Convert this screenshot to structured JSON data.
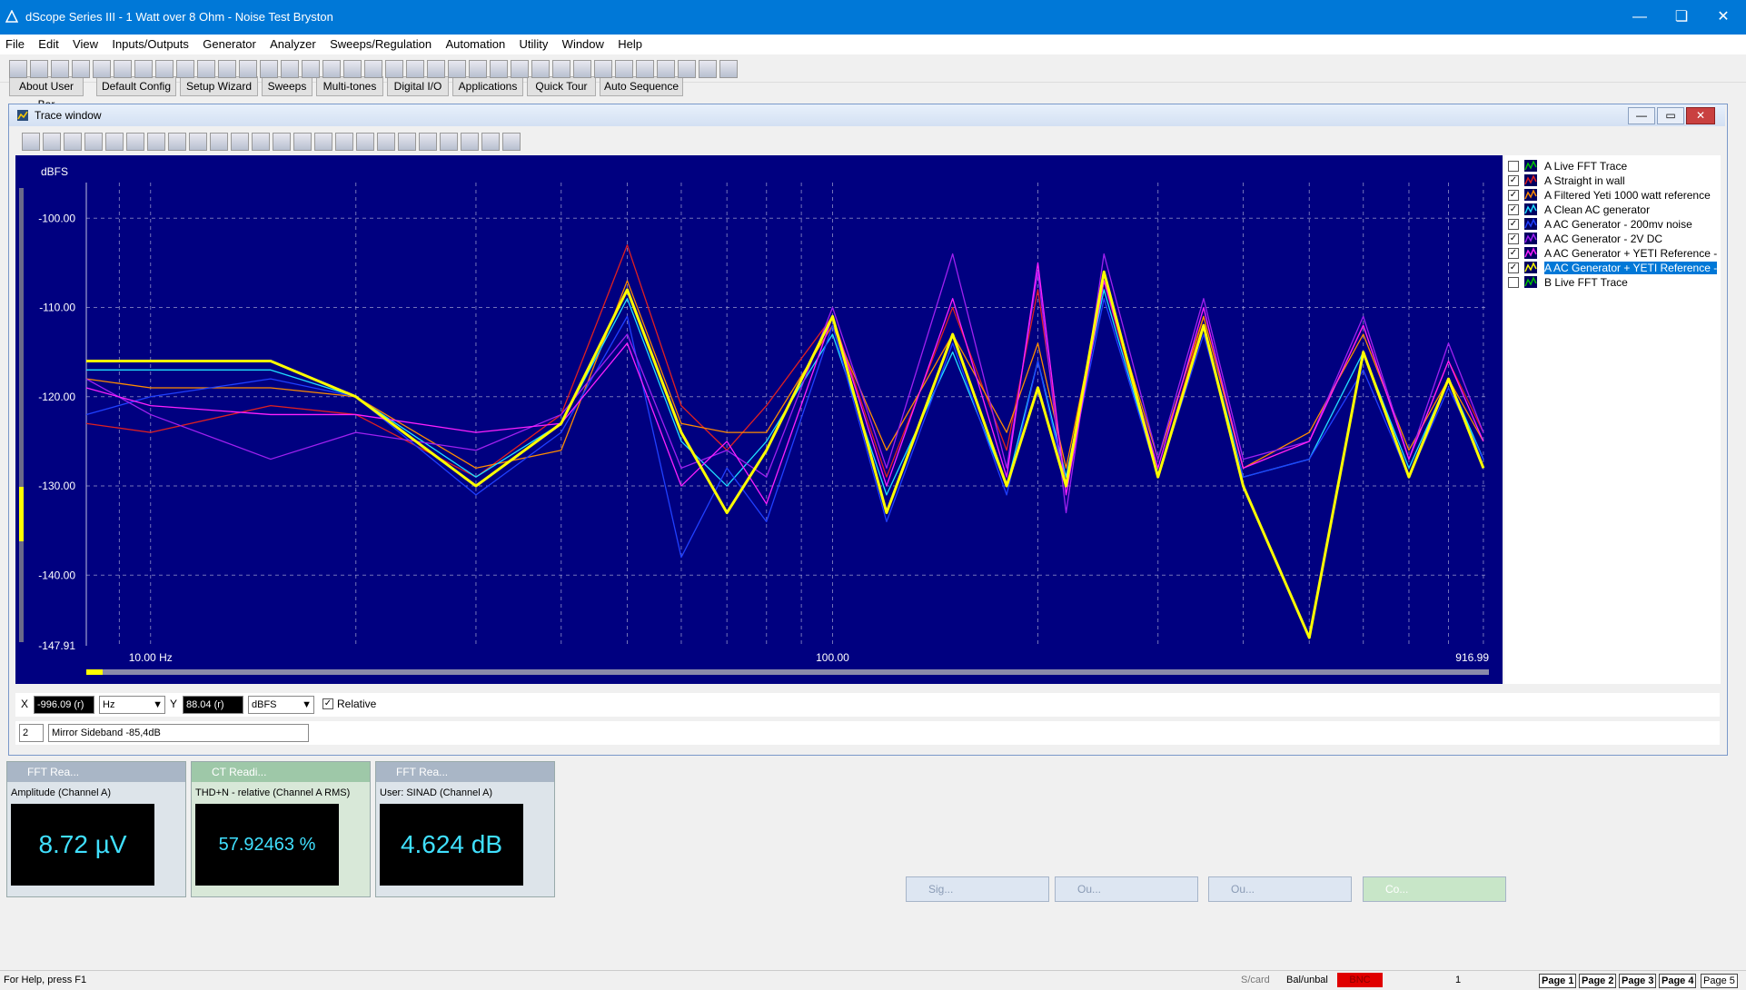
{
  "app": {
    "title": "dScope Series III - 1 Watt over 8 Ohm - Noise Test Bryston",
    "menu": [
      "File",
      "Edit",
      "View",
      "Inputs/Outputs",
      "Generator",
      "Analyzer",
      "Sweeps/Regulation",
      "Automation",
      "Utility",
      "Window",
      "Help"
    ]
  },
  "userbar": [
    "About User Bar",
    "Default Config",
    "Setup Wizard",
    "Sweeps",
    "Multi-tones",
    "Digital I/O",
    "Applications",
    "Quick Tour",
    "Auto Sequence"
  ],
  "trace_window": {
    "title": "Trace window",
    "legend": [
      {
        "label": "A  Live FFT Trace",
        "checked": false,
        "color": "#00c000"
      },
      {
        "label": "A  Straight in wall",
        "checked": true,
        "color": "#e02020"
      },
      {
        "label": "A  Filtered Yeti 1000 watt reference",
        "checked": true,
        "color": "#ff8c00"
      },
      {
        "label": "A  Clean AC generator",
        "checked": true,
        "color": "#20e0ff"
      },
      {
        "label": "A   AC Generator - 200mv noise",
        "checked": true,
        "color": "#2040ff"
      },
      {
        "label": "A  AC Generator - 2V DC",
        "checked": true,
        "color": "#a020f0"
      },
      {
        "label": "A  AC Generator + YETI Reference -",
        "checked": true,
        "color": "#ff20ff"
      },
      {
        "label": "A  AC Generator + YETI Reference -",
        "checked": true,
        "color": "#ffff00",
        "selected": true
      },
      {
        "label": "B  Live FFT Trace",
        "checked": false,
        "color": "#00c000"
      }
    ],
    "x_field": "-996.09 (r)",
    "x_unit": "Hz",
    "y_field": "88.04 (r)",
    "y_unit": "dBFS",
    "relative_label": "Relative",
    "marker_num": "2",
    "marker_text": "Mirror Sideband -85,4dB"
  },
  "chart_data": {
    "type": "line",
    "ylabel": "dBFS",
    "x_scale": "log",
    "xlim": [
      8.05,
      916.99
    ],
    "ylim": [
      -147.91,
      -96
    ],
    "y_ticks": [
      "-100.00",
      "-110.00",
      "-120.00",
      "-130.00",
      "-140.00",
      "-147.91"
    ],
    "x_ticks": [
      "10.00 Hz",
      "100.00",
      "916.99"
    ],
    "grid": true,
    "series": [
      {
        "name": "Straight in wall",
        "color": "#e02020",
        "x": [
          8,
          10,
          15,
          20,
          30,
          40,
          50,
          60,
          70,
          80,
          100,
          120,
          150,
          180,
          200,
          220,
          250,
          300,
          350,
          400,
          500,
          600,
          700,
          800,
          900
        ],
        "y": [
          -123,
          -124,
          -121,
          -122,
          -129,
          -122,
          -103,
          -121,
          -126,
          -121,
          -111,
          -129,
          -110,
          -126,
          -108,
          -130,
          -107,
          -129,
          -111,
          -128,
          -125,
          -112,
          -127,
          -116,
          -124
        ]
      },
      {
        "name": "Filtered Yeti 1000 watt reference",
        "color": "#ff8c00",
        "x": [
          8,
          10,
          15,
          20,
          30,
          40,
          50,
          60,
          70,
          80,
          100,
          120,
          150,
          180,
          200,
          220,
          250,
          300,
          350,
          400,
          500,
          600,
          700,
          800,
          900
        ],
        "y": [
          -118,
          -119,
          -119,
          -120,
          -128,
          -126,
          -107,
          -123,
          -124,
          -124,
          -112,
          -126,
          -113,
          -124,
          -114,
          -128,
          -107,
          -127,
          -111,
          -128,
          -124,
          -113,
          -126,
          -118,
          -125
        ]
      },
      {
        "name": "Clean AC generator",
        "color": "#20e0ff",
        "x": [
          8,
          10,
          15,
          20,
          30,
          40,
          50,
          60,
          70,
          80,
          100,
          120,
          150,
          180,
          200,
          220,
          250,
          300,
          350,
          400,
          500,
          600,
          700,
          800,
          900
        ],
        "y": [
          -117,
          -117,
          -117,
          -120,
          -129,
          -123,
          -109,
          -125,
          -130,
          -125,
          -113,
          -131,
          -115,
          -130,
          -116,
          -129,
          -108,
          -129,
          -112,
          -129,
          -127,
          -115,
          -128,
          -118,
          -127
        ]
      },
      {
        "name": "AC Generator - 200mv noise",
        "color": "#2040ff",
        "x": [
          8,
          10,
          15,
          20,
          30,
          40,
          50,
          60,
          70,
          80,
          100,
          120,
          150,
          180,
          200,
          220,
          250,
          300,
          350,
          400,
          500,
          600,
          700,
          800,
          900
        ],
        "y": [
          -122,
          -120,
          -118,
          -120,
          -131,
          -124,
          -111,
          -138,
          -128,
          -134,
          -112,
          -134,
          -114,
          -131,
          -116,
          -130,
          -109,
          -129,
          -113,
          -129,
          -127,
          -117,
          -129,
          -119,
          -127
        ]
      },
      {
        "name": "AC Generator - 2V DC",
        "color": "#a020f0",
        "x": [
          8,
          10,
          15,
          20,
          30,
          40,
          50,
          60,
          70,
          80,
          100,
          120,
          150,
          180,
          200,
          220,
          250,
          300,
          350,
          400,
          500,
          600,
          700,
          800,
          900
        ],
        "y": [
          -118,
          -122,
          -127,
          -124,
          -126,
          -122,
          -113,
          -128,
          -126,
          -129,
          -110,
          -128,
          -104,
          -128,
          -106,
          -133,
          -104,
          -127,
          -109,
          -127,
          -125,
          -111,
          -127,
          -114,
          -124
        ]
      },
      {
        "name": "AC Generator + YETI Reference",
        "color": "#ff20ff",
        "x": [
          8,
          10,
          15,
          20,
          30,
          40,
          50,
          60,
          70,
          80,
          100,
          120,
          150,
          180,
          200,
          220,
          250,
          300,
          350,
          400,
          500,
          600,
          700,
          800,
          900
        ],
        "y": [
          -119,
          -121,
          -122,
          -122,
          -124,
          -123,
          -114,
          -130,
          -125,
          -132,
          -111,
          -130,
          -109,
          -129,
          -105,
          -131,
          -107,
          -128,
          -110,
          -128,
          -125,
          -112,
          -127,
          -116,
          -125
        ]
      },
      {
        "name": "AC Generator + YETI Reference",
        "color": "#ffff00",
        "x": [
          8,
          10,
          15,
          20,
          30,
          40,
          50,
          60,
          70,
          80,
          100,
          120,
          150,
          180,
          200,
          220,
          250,
          300,
          350,
          400,
          500,
          600,
          700,
          800,
          900
        ],
        "y": [
          -116,
          -116,
          -116,
          -120,
          -130,
          -123,
          -108,
          -124,
          -133,
          -126,
          -111,
          -133,
          -113,
          -130,
          -119,
          -130,
          -106,
          -129,
          -112,
          -130,
          -147,
          -115,
          -129,
          -118,
          -128
        ]
      }
    ]
  },
  "readings": [
    {
      "title": "FFT Rea...",
      "label": "Amplitude (Channel A)",
      "value": "8.72 µV"
    },
    {
      "title": "CT Readi...",
      "label": "THD+N - relative (Channel A RMS)",
      "value": "57.92463 %"
    },
    {
      "title": "FFT Rea...",
      "label": "User: SINAD (Channel A)",
      "value": "4.624 dB"
    }
  ],
  "minimized": [
    "Sig...",
    "Ou...",
    "Ou...",
    "Co..."
  ],
  "status": {
    "help": "For Help, press F1",
    "scard": "S/card",
    "balunbal": "Bal/unbal",
    "bnc": "BNC",
    "one": "1",
    "pages": [
      "Page 1",
      "Page 2",
      "Page 3",
      "Page 4",
      "Page 5"
    ]
  }
}
